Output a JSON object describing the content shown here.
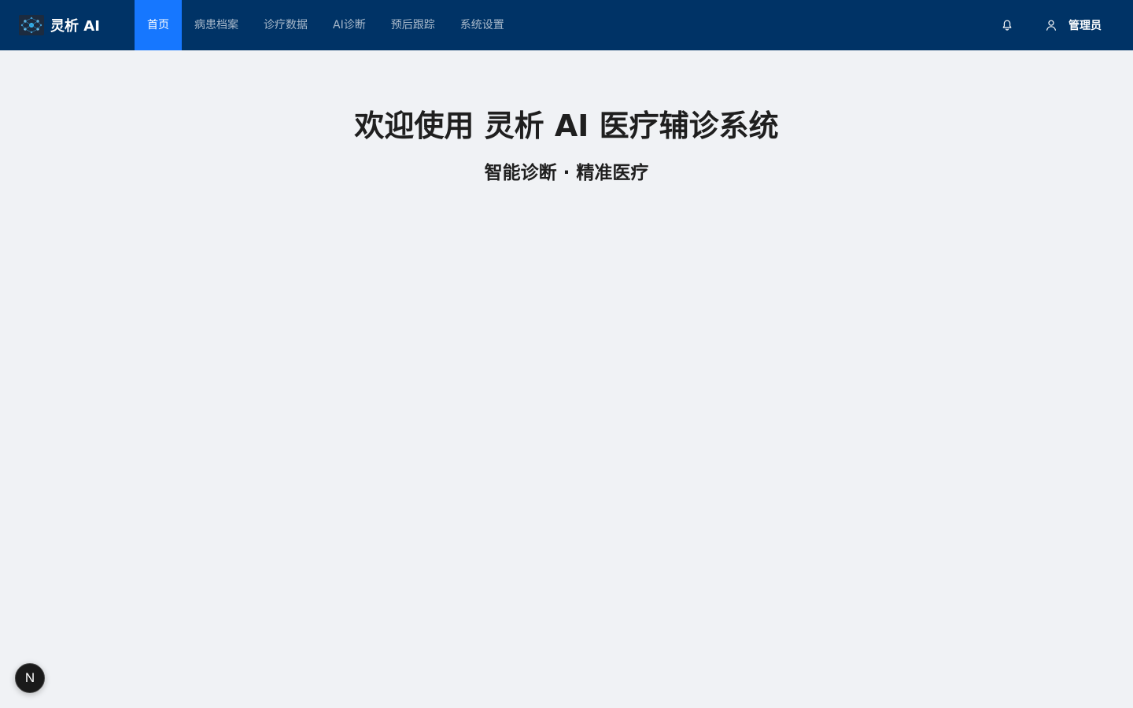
{
  "header": {
    "brand_name": "灵析 AI",
    "nav_items": [
      {
        "label": "首页",
        "active": true
      },
      {
        "label": "病患档案",
        "active": false
      },
      {
        "label": "诊疗数据",
        "active": false
      },
      {
        "label": "AI诊断",
        "active": false
      },
      {
        "label": "预后跟踪",
        "active": false
      },
      {
        "label": "系统设置",
        "active": false
      }
    ],
    "user_name": "管理员"
  },
  "main": {
    "title": "欢迎使用 灵析 AI 医疗辅诊系统",
    "subtitle": "智能诊断 · 精准医疗"
  },
  "dev_badge": {
    "letter": "N"
  },
  "colors": {
    "header_bg": "#003366",
    "nav_active_bg": "#1677ff",
    "page_bg": "#f0f2f5",
    "text_dark": "#1f1f1f"
  },
  "icons": {
    "logo": "network-logo-icon",
    "notifications": "bell-icon",
    "user": "user-icon"
  }
}
